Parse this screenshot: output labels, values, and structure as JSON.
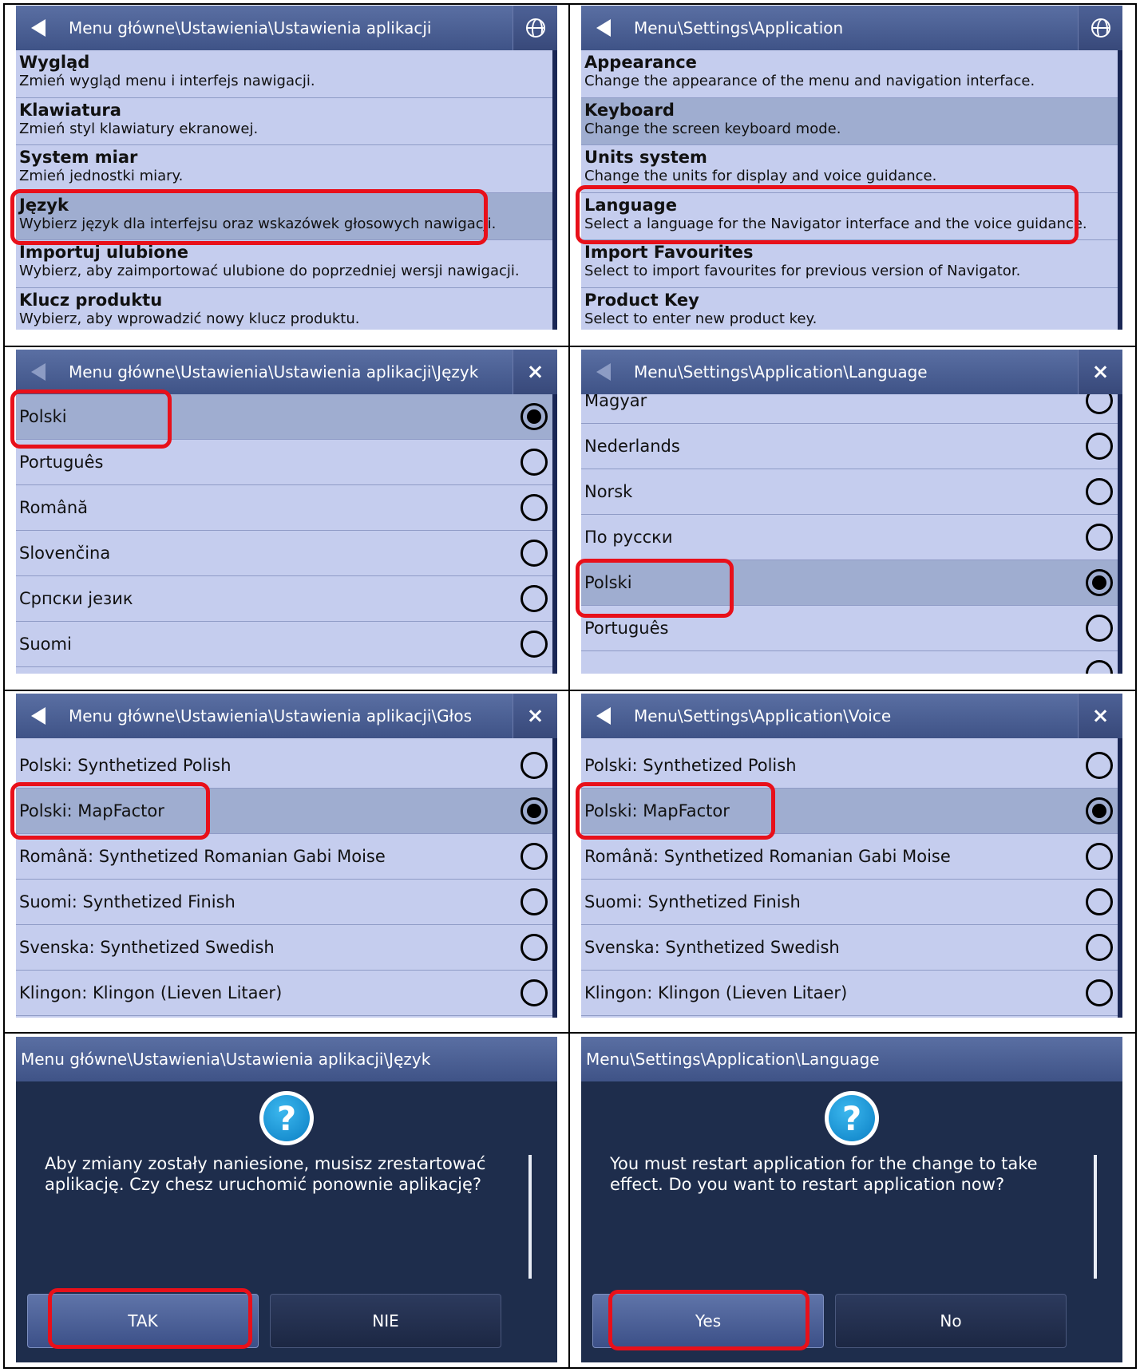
{
  "panels": {
    "settings_pl": {
      "title": "Menu główne\\Ustawienia\\Ustawienia aplikacji",
      "items": [
        {
          "title": "Wygląd",
          "desc": "Zmień wygląd menu i interfejs nawigacji."
        },
        {
          "title": "Klawiatura",
          "desc": "Zmień styl klawiatury ekranowej."
        },
        {
          "title": "System miar",
          "desc": "Zmień jednostki miary."
        },
        {
          "title": "Język",
          "desc": "Wybierz język dla interfejsu oraz wskazówek głosowych nawigacji."
        },
        {
          "title": "Importuj ulubione",
          "desc": "Wybierz, aby zaimportować ulubione do poprzedniej wersji nawigacji."
        },
        {
          "title": "Klucz produktu",
          "desc": "Wybierz, aby wprowadzić nowy klucz produktu."
        }
      ]
    },
    "settings_en": {
      "title": "Menu\\Settings\\Application",
      "items": [
        {
          "title": "Appearance",
          "desc": "Change the appearance of the menu and navigation interface."
        },
        {
          "title": "Keyboard",
          "desc": "Change the screen keyboard mode."
        },
        {
          "title": "Units system",
          "desc": "Change the units for display and voice guidance."
        },
        {
          "title": "Language",
          "desc": "Select a language for the Navigator interface and the voice guidance."
        },
        {
          "title": "Import Favourites",
          "desc": "Select to import favourites for previous version of Navigator."
        },
        {
          "title": "Product Key",
          "desc": "Select to enter new product key."
        }
      ]
    },
    "language_pl": {
      "title": "Menu główne\\Ustawienia\\Ustawienia aplikacji\\Język",
      "close_icon": "×",
      "options": [
        "Polski",
        "Português",
        "Română",
        "Slovenčina",
        "Српски језик",
        "Suomi"
      ],
      "selected": "Polski"
    },
    "language_en": {
      "title": "Menu\\Settings\\Application\\Language",
      "close_icon": "×",
      "options": [
        "Magyar",
        "Nederlands",
        "Norsk",
        "По русски",
        "Polski",
        "Português"
      ],
      "selected": "Polski"
    },
    "voice_pl": {
      "title": "Menu główne\\Ustawienia\\Ustawienia aplikacji\\Głos",
      "close_icon": "×",
      "options": [
        "Polski: Synthetized Polish",
        "Polski: MapFactor",
        "Română: Synthetized Romanian Gabi Moise",
        "Suomi: Synthetized Finish",
        "Svenska: Synthetized Swedish",
        "Klingon: Klingon (Lieven Litaer)"
      ],
      "selected": "Polski: MapFactor"
    },
    "voice_en": {
      "title": "Menu\\Settings\\Application\\Voice",
      "close_icon": "×",
      "options": [
        "Polski: Synthetized Polish",
        "Polski: MapFactor",
        "Română: Synthetized Romanian Gabi Moise",
        "Suomi: Synthetized Finish",
        "Svenska: Synthetized Swedish",
        "Klingon: Klingon (Lieven Litaer)"
      ],
      "selected": "Polski: MapFactor"
    },
    "restart_pl": {
      "title": "Menu główne\\Ustawienia\\Ustawienia aplikacji\\Język",
      "icon": "?",
      "message": "Aby zmiany zostały naniesione, musisz zrestartować aplikację. Czy chesz uruchomić ponownie aplikację?",
      "yes_label": "TAK",
      "no_label": "NIE"
    },
    "restart_en": {
      "title": "Menu\\Settings\\Application\\Language",
      "icon": "?",
      "message": "You must restart application for the change to take effect. Do you want to restart application now?",
      "yes_label": "Yes",
      "no_label": "No"
    }
  },
  "colors": {
    "list_bg": "#c5cdee",
    "selected_row": "#9fadd0",
    "titlebar": "#4a5e94",
    "dialog_bg": "#1e2d4c",
    "highlight": "#e8101a"
  }
}
